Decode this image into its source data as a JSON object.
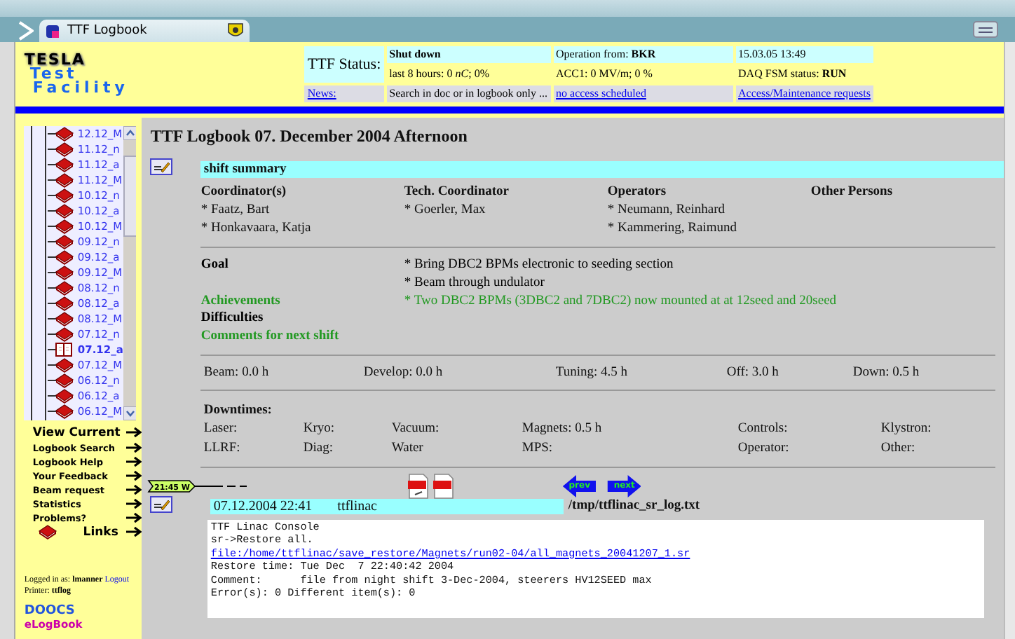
{
  "browser": {
    "tab_title": "TTF Logbook"
  },
  "header": {
    "logo": [
      "TESLA",
      "Test",
      "Facility"
    ],
    "status_label": "TTF Status:",
    "status_rows": [
      [
        "Shut down",
        "Operation from: **BKR**",
        "15.03.05 13:49"
      ],
      [
        "last 8 hours: 0 *nC*; 0%",
        "ACC1: 0 MV/m; 0 %",
        "DAQ FSM status: **RUN**"
      ]
    ],
    "news": {
      "label": "News:",
      "cells": [
        {
          "text": "Search in doc or in logbook only ...",
          "kind": "text"
        },
        {
          "text": "no access scheduled",
          "kind": "link"
        },
        {
          "text": "Access/Maintenance requests",
          "kind": "link"
        }
      ]
    }
  },
  "sidebar": {
    "tree": [
      {
        "label": "12.12_M",
        "selected": false
      },
      {
        "label": "11.12_n",
        "selected": false
      },
      {
        "label": "11.12_a",
        "selected": false
      },
      {
        "label": "11.12_M",
        "selected": false
      },
      {
        "label": "10.12_n",
        "selected": false
      },
      {
        "label": "10.12_a",
        "selected": false
      },
      {
        "label": "10.12_M",
        "selected": false
      },
      {
        "label": "09.12_n",
        "selected": false
      },
      {
        "label": "09.12_a",
        "selected": false
      },
      {
        "label": "09.12_M",
        "selected": false
      },
      {
        "label": "08.12_n",
        "selected": false
      },
      {
        "label": "08.12_a",
        "selected": false
      },
      {
        "label": "08.12_M",
        "selected": false
      },
      {
        "label": "07.12_n",
        "selected": false
      },
      {
        "label": "07.12_a",
        "selected": true
      },
      {
        "label": "07.12_M",
        "selected": false
      },
      {
        "label": "06.12_n",
        "selected": false
      },
      {
        "label": "06.12_a",
        "selected": false
      },
      {
        "label": "06.12_M",
        "selected": false
      }
    ],
    "nav": [
      {
        "label": "View Current",
        "kind": "main"
      },
      {
        "label": "Logbook Search",
        "kind": "sub"
      },
      {
        "label": "Logbook Help",
        "kind": "sub"
      },
      {
        "label": "Your Feedback",
        "kind": "sub"
      },
      {
        "label": "Beam request",
        "kind": "sub"
      },
      {
        "label": "Statistics",
        "kind": "sub"
      },
      {
        "label": "Problems?",
        "kind": "sub"
      },
      {
        "label": "Links",
        "kind": "book"
      }
    ],
    "login": {
      "prefix": "Logged in as:",
      "user": "lmanner",
      "logout": "Logout",
      "printer_label": "Printer:",
      "printer": "ttflog"
    },
    "logo": [
      "DOOCS",
      "eLogBook"
    ]
  },
  "main": {
    "title": "TTF Logbook 07. December 2004 Afternoon",
    "summary": {
      "heading": "shift summary",
      "columns": [
        {
          "title": "Coordinator(s)",
          "names": [
            "* Faatz, Bart",
            "* Honkavaara, Katja"
          ]
        },
        {
          "title": "Tech. Coordinator",
          "names": [
            "* Goerler, Max"
          ]
        },
        {
          "title": "Operators",
          "names": [
            "* Neumann, Reinhard",
            "* Kammering, Raimund"
          ]
        },
        {
          "title": "Other Persons"
        }
      ]
    },
    "goals": [
      {
        "label": "Goal",
        "values": [
          "* Bring DBC2 BPMs electronic to seeding section",
          "* Beam through undulator"
        ],
        "color": "#000000"
      },
      {
        "label": "Achievements",
        "values": [
          "* Two DBC2 BPMs (3DBC2 and 7DBC2) now mounted at at 12seed and 20seed"
        ],
        "color": "#229922"
      },
      {
        "label": "Difficulties",
        "color": "#000000"
      },
      {
        "label": "Comments for next shift",
        "color": "#229922"
      }
    ],
    "times": [
      "Beam: 0.0 h",
      "Develop: 0.0 h",
      "Tuning: 4.5 h",
      "Off: 3.0 h",
      "Down: 0.5 h"
    ],
    "downtimes": {
      "title": "Downtimes:",
      "rows": [
        [
          "Laser:",
          "Kryo:",
          "Vacuum:",
          "Magnets: 0.5 h",
          "Controls:",
          "Klystron:"
        ],
        [
          "LLRF:",
          "Diag:",
          "Water",
          "MPS:",
          "Operator:",
          "Other:"
        ]
      ]
    },
    "timeline": {
      "marker": "21:45 W",
      "prev": "prev",
      "next": "next"
    },
    "entry": {
      "time": "07.12.2004 22:41",
      "author": "ttflinac",
      "file": "/tmp/ttflinac_sr_log.txt",
      "lines": [
        {
          "text": "TTF Linac Console",
          "kind": "text"
        },
        {
          "text": "sr->Restore all.",
          "kind": "text"
        },
        {
          "text": "file:/home/ttflinac/save_restore/Magnets/run02-04/all_magnets_20041207_1.sr",
          "kind": "link"
        },
        {
          "text": "Restore time: Tue Dec  7 22:40:42 2004",
          "kind": "text"
        },
        {
          "text": "Comment:      file from night shift 3-Dec-2004, steerers HV12SEED max",
          "kind": "text"
        },
        {
          "text": "Error(s): 0 Different item(s): 0",
          "kind": "text"
        }
      ]
    }
  }
}
